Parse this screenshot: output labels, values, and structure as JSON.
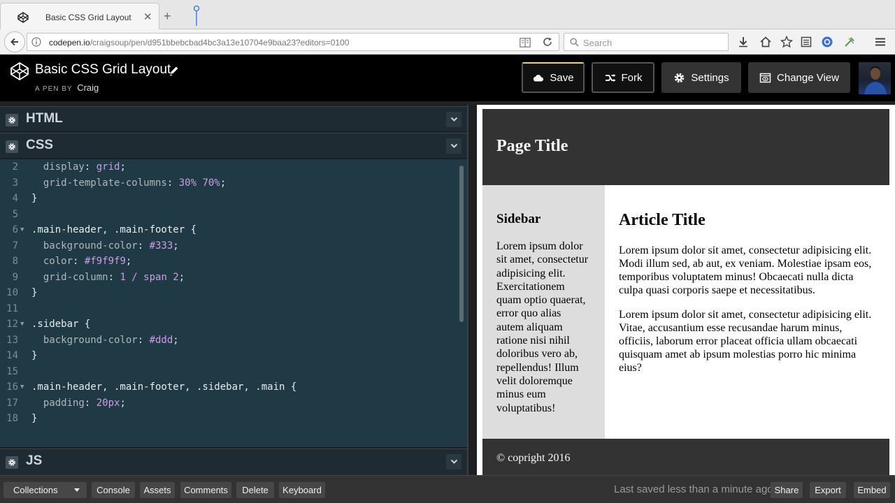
{
  "browser": {
    "tab_title": "Basic CSS Grid Layout",
    "url_host": "codepen.io",
    "url_path": "/craigsoup/pen/d951bbebcbad4bc3a13e10704e9baa23?editors=0100",
    "search_placeholder": "Search",
    "toolbar_icons": [
      "download-icon",
      "home-icon",
      "bookmark-star-icon",
      "reading-list-icon",
      "extension-icon",
      "tools-icon",
      "menu-icon"
    ]
  },
  "pen": {
    "title": "Basic CSS Grid Layout",
    "byline_prefix": "A PEN BY",
    "author": "Craig",
    "buttons": {
      "save": "Save",
      "fork": "Fork",
      "settings": "Settings",
      "change_view": "Change View"
    }
  },
  "editors": {
    "html_label": "HTML",
    "css_label": "CSS",
    "js_label": "JS",
    "css_lines": [
      {
        "n": "2",
        "fold": false,
        "text": "  display: grid;"
      },
      {
        "n": "3",
        "fold": false,
        "text": "  grid-template-columns: 30% 70%;"
      },
      {
        "n": "4",
        "fold": false,
        "text": "}"
      },
      {
        "n": "5",
        "fold": false,
        "text": ""
      },
      {
        "n": "6",
        "fold": true,
        "text": ".main-header, .main-footer {"
      },
      {
        "n": "7",
        "fold": false,
        "text": "  background-color: #333;"
      },
      {
        "n": "8",
        "fold": false,
        "text": "  color: #f9f9f9;"
      },
      {
        "n": "9",
        "fold": false,
        "text": "  grid-column: 1 / span 2;"
      },
      {
        "n": "10",
        "fold": false,
        "text": "}"
      },
      {
        "n": "11",
        "fold": false,
        "text": ""
      },
      {
        "n": "12",
        "fold": true,
        "text": ".sidebar {"
      },
      {
        "n": "13",
        "fold": false,
        "text": "  background-color: #ddd;"
      },
      {
        "n": "14",
        "fold": false,
        "text": "}"
      },
      {
        "n": "15",
        "fold": false,
        "text": ""
      },
      {
        "n": "16",
        "fold": true,
        "text": ".main-header, .main-footer, .sidebar, .main {"
      },
      {
        "n": "17",
        "fold": false,
        "text": "  padding: 20px;"
      },
      {
        "n": "18",
        "fold": false,
        "text": "}"
      }
    ]
  },
  "preview": {
    "page_title": "Page Title",
    "sidebar_title": "Sidebar",
    "sidebar_text": "Lorem ipsum dolor sit amet, consectetur adipisicing elit. Exercitationem quam optio quaerat, error quo alias autem aliquam ratione nisi nihil doloribus vero ab, repellendus! Illum velit doloremque minus eum voluptatibus!",
    "article_title": "Article Title",
    "paragraph_1": "Lorem ipsum dolor sit amet, consectetur adipisicing elit. Modi illum sed, ab aut, ex veniam. Molestiae ipsam eos, temporibus voluptatem minus! Obcaecati nulla dicta culpa quasi corporis saepe et necessitatibus.",
    "paragraph_2": "Lorem ipsum dolor sit amet, consectetur adipisicing elit. Vitae, accusantium esse recusandae harum minus, officiis, laborum error placeat officia ullam obcaecati quisquam amet ab ipsum molestias porro hic minima eius?",
    "footer_text": "© copright 2016"
  },
  "bottom_bar": {
    "collections": "Collections",
    "console": "Console",
    "assets": "Assets",
    "comments": "Comments",
    "delete": "Delete",
    "keyboard": "Keyboard",
    "saved_status": "Last saved less than a minute ago",
    "share": "Share",
    "export": "Export",
    "embed": "Embed"
  },
  "colors": {
    "save_accent": "#f7d34a",
    "editor_bg": "#1f3a44",
    "code_value": "#ca9ee6",
    "preview_header_bg": "#333333",
    "preview_sidebar_bg": "#dddddd"
  }
}
